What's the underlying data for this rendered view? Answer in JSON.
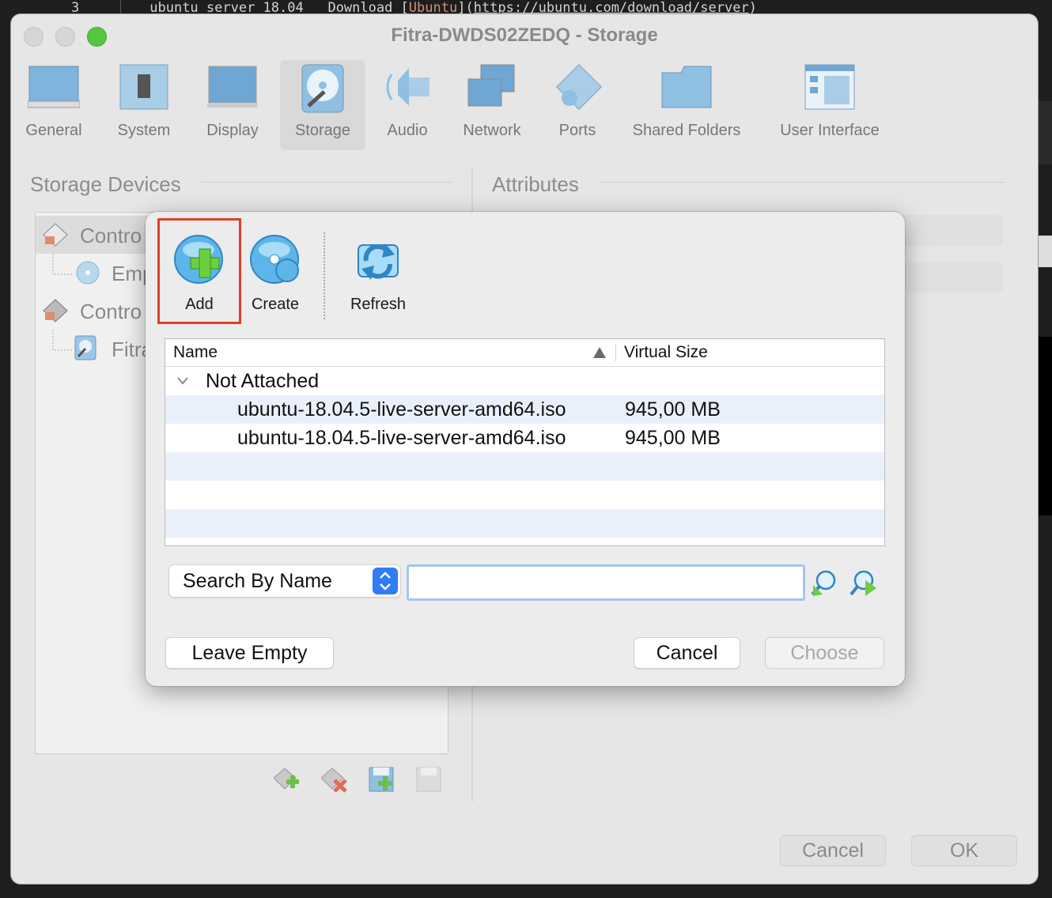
{
  "terminal": {
    "prefix": "3",
    "text_a": "ubuntu server 18.04",
    "text_b": "Download [",
    "text_bracket": "Ubuntu",
    "text_c": "](",
    "text_link": "https://ubuntu.com/download/server",
    "text_d": ")"
  },
  "window": {
    "title": "Fitra-DWDS02ZEDQ - Storage",
    "toolbar": [
      {
        "label": "General"
      },
      {
        "label": "System"
      },
      {
        "label": "Display"
      },
      {
        "label": "Storage"
      },
      {
        "label": "Audio"
      },
      {
        "label": "Network"
      },
      {
        "label": "Ports"
      },
      {
        "label": "Shared Folders"
      },
      {
        "label": "User Interface"
      }
    ],
    "storage_devices_title": "Storage Devices",
    "attributes_title": "Attributes",
    "tree": [
      {
        "label": "Contro"
      },
      {
        "label": "Emp"
      },
      {
        "label": "Contro"
      },
      {
        "label": "Fitra"
      }
    ],
    "cancel_label": "Cancel",
    "ok_label": "OK"
  },
  "dialog": {
    "tools": {
      "add_label": "Add",
      "create_label": "Create",
      "refresh_label": "Refresh"
    },
    "table": {
      "col_name": "Name",
      "col_size": "Virtual Size",
      "group": "Not Attached",
      "rows": [
        {
          "name": "ubuntu-18.04.5-live-server-amd64.iso",
          "size": "945,00 MB"
        },
        {
          "name": "ubuntu-18.04.5-live-server-amd64.iso",
          "size": "945,00 MB"
        }
      ]
    },
    "search": {
      "mode": "Search By Name",
      "value": ""
    },
    "leave_empty_label": "Leave Empty",
    "cancel_label": "Cancel",
    "choose_label": "Choose"
  },
  "colors": {
    "accent": "#2f7cf6",
    "highlight": "#e0402a",
    "selection_row": "#eaf0fb"
  }
}
